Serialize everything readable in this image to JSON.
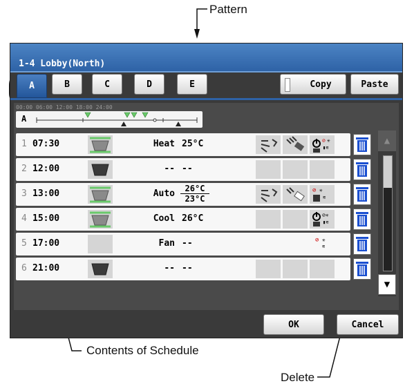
{
  "annotations": {
    "pattern": "Pattern",
    "contents": "Contents of Schedule",
    "delete": "Delete"
  },
  "window": {
    "title": "1-4 Lobby(North)"
  },
  "patterns": [
    "A",
    "B",
    "C",
    "D",
    "E"
  ],
  "active_pattern": "A",
  "toolbar": {
    "copy_label": "Copy",
    "paste_label": "Paste"
  },
  "timeline": {
    "label": "A",
    "ticks": "00:00    06:00    12:00    18:00    24:00"
  },
  "schedule": [
    {
      "num": "1",
      "time": "07:30",
      "unit_icon": "indoor-unit-on-icon",
      "mode": "Heat",
      "temp": "25°C",
      "icons": [
        "airflow-direction-icon",
        "fan-speed-icon",
        "onoff-setback-icon"
      ]
    },
    {
      "num": "2",
      "time": "12:00",
      "unit_icon": "indoor-unit-off-icon",
      "mode": "--",
      "temp": "--",
      "icons": []
    },
    {
      "num": "3",
      "time": "13:00",
      "unit_icon": "indoor-unit-on-icon",
      "mode": "Auto",
      "temp_high": "26°C",
      "temp_low": "23°C",
      "icons": [
        "airflow-direction-icon",
        "fan-speed-icon",
        "onoff-setback-icon"
      ]
    },
    {
      "num": "4",
      "time": "15:00",
      "unit_icon": "indoor-unit-on-icon",
      "mode": "Cool",
      "temp": "26°C",
      "icons": [
        "onoff-setback-icon"
      ]
    },
    {
      "num": "5",
      "time": "17:00",
      "unit_icon": "none",
      "mode": "Fan",
      "temp": "--",
      "icons": [
        "onoff-setback-icon"
      ]
    },
    {
      "num": "6",
      "time": "21:00",
      "unit_icon": "indoor-unit-off-icon",
      "mode": "--",
      "temp": "--",
      "icons": []
    }
  ],
  "footer": {
    "ok_label": "OK",
    "cancel_label": "Cancel"
  },
  "colors": {
    "title_bar": "#2e62a6",
    "accent_green": "#69c96a",
    "trash_blue": "#1a4fd0"
  }
}
